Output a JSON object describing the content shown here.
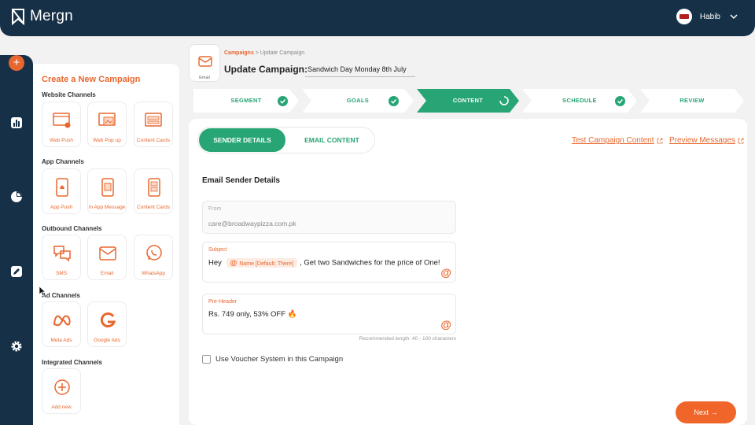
{
  "app": {
    "brand": "Mergn",
    "user_name": "Habib",
    "accent": "#e8672e",
    "primary": "#163047",
    "success": "#27a574"
  },
  "create_panel": {
    "title": "Create a New Campaign",
    "sections": [
      {
        "title": "Website Channels",
        "items": [
          {
            "label": "Web Push",
            "icon": "web-push-icon"
          },
          {
            "label": "Web Pop up",
            "icon": "web-popup-icon"
          },
          {
            "label": "Content Cards",
            "icon": "content-cards-icon"
          }
        ]
      },
      {
        "title": "App Channels",
        "items": [
          {
            "label": "App Push",
            "icon": "app-push-icon"
          },
          {
            "label": "In App Message",
            "icon": "in-app-message-icon"
          },
          {
            "label": "Content Cards",
            "icon": "app-content-cards-icon"
          }
        ]
      },
      {
        "title": "Outbound Channels",
        "items": [
          {
            "label": "SMS",
            "icon": "sms-icon"
          },
          {
            "label": "Email",
            "icon": "email-icon"
          },
          {
            "label": "WhatsApp",
            "icon": "whatsapp-icon"
          }
        ]
      },
      {
        "title": "Ad Channels",
        "items": [
          {
            "label": "Meta Ads",
            "icon": "meta-icon"
          },
          {
            "label": "Google Ads",
            "icon": "google-icon"
          }
        ]
      },
      {
        "title": "Integrated Channels",
        "items": [
          {
            "label": "Add new",
            "icon": "add-circle-icon"
          }
        ]
      }
    ]
  },
  "header": {
    "badge_label": "Email",
    "breadcrumb_root": "Campaigns",
    "breadcrumb_sep": ">",
    "breadcrumb_current": "Update Campaign",
    "title": "Update Campaign:",
    "campaign_name": "Sandwich Day Monday 8th July"
  },
  "steps": [
    {
      "label": "SEGMENT",
      "status": "done"
    },
    {
      "label": "GOALS",
      "status": "done"
    },
    {
      "label": "CONTENT",
      "status": "active"
    },
    {
      "label": "SCHEDULE",
      "status": "done"
    },
    {
      "label": "REVIEW",
      "status": "pending"
    }
  ],
  "content": {
    "tab_sender": "SENDER DETAILS",
    "tab_email": "EMAIL CONTENT",
    "link_test": "Test Campaign Content",
    "link_preview": "Preview Messages",
    "heading": "Email Sender Details",
    "from_label": "From",
    "from_value": "care@broadwaypizza.com.pk",
    "subject_label": "Subject",
    "subject_prefix": "Hey",
    "subject_tag": "Name [Default: There]",
    "subject_suffix": ", Get two Sandwiches for the price of One!",
    "preheader_label": "Pre-Header",
    "preheader_value": "Rs. 749 only, 53% OFF 🔥",
    "hint": "Recommended length: 40 - 100 characters",
    "voucher_label": "Use Voucher System in this Campaign",
    "at_symbol": "@",
    "next_label": "Next →"
  }
}
